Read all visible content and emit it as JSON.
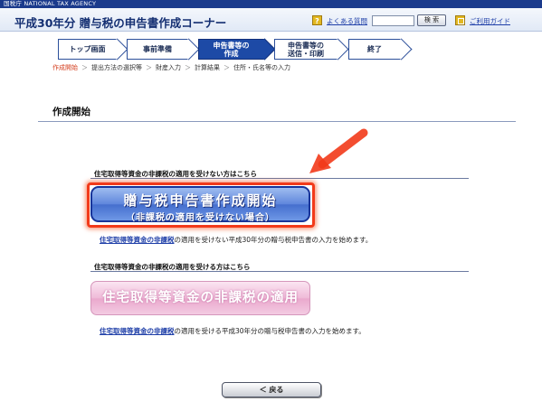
{
  "agency_label": "国税庁 NATIONAL TAX AGENCY",
  "header": {
    "title": "平成30年分 贈与税の申告書作成コーナー",
    "faq_icon_glyph": "?",
    "faq_link": "よくある質問",
    "search_input_value": "",
    "search_button": "検 索",
    "guide_link": "ご利用ガイド"
  },
  "steps": [
    {
      "label": "トップ画面",
      "active": false
    },
    {
      "label": "事前準備",
      "active": false
    },
    {
      "label": "申告書等の作成",
      "line1": "申告書等の",
      "line2": "作成",
      "active": true
    },
    {
      "label": "申告書等の送信・印刷",
      "line1": "申告書等の",
      "line2": "送信・印刷",
      "active": false
    },
    {
      "label": "終了",
      "active": false
    }
  ],
  "breadcrumb": [
    "作成開始",
    "提出方法の選択等",
    "財産入力",
    "計算結果",
    "住所・氏名等の入力"
  ],
  "section_title": "作成開始",
  "panel_nonexempt": {
    "heading": "住宅取得等資金の非課税の適用を受けない方はこちら",
    "button_line1": "贈与税申告書作成開始",
    "button_line2": "（非課税の適用を受けない場合）",
    "desc_link": "住宅取得等資金の非課税",
    "desc_rest": "の適用を受けない平成30年分の贈与税申告書の入力を始めます。"
  },
  "panel_exempt": {
    "heading": "住宅取得等資金の非課税の適用を受ける方はこちら",
    "button_label": "住宅取得等資金の非課税の適用",
    "desc_link": "住宅取得等資金の非課税",
    "desc_rest": "の適用を受ける平成30年分の贈与税申告書の入力を始めます。"
  },
  "back_button": "＜ 戻る",
  "colors": {
    "brand_navy": "#1b3a8c",
    "active_step": "#1d4aa6",
    "highlight_red": "#f23a1a",
    "primary_button_blue": "#5f86dc",
    "secondary_button_pink": "#efbad8",
    "link_blue": "#1f3fa8"
  },
  "icons": {
    "faq": "question-mark-icon",
    "guide": "guide-book-icon",
    "annotation": "red-arrow-icon"
  }
}
